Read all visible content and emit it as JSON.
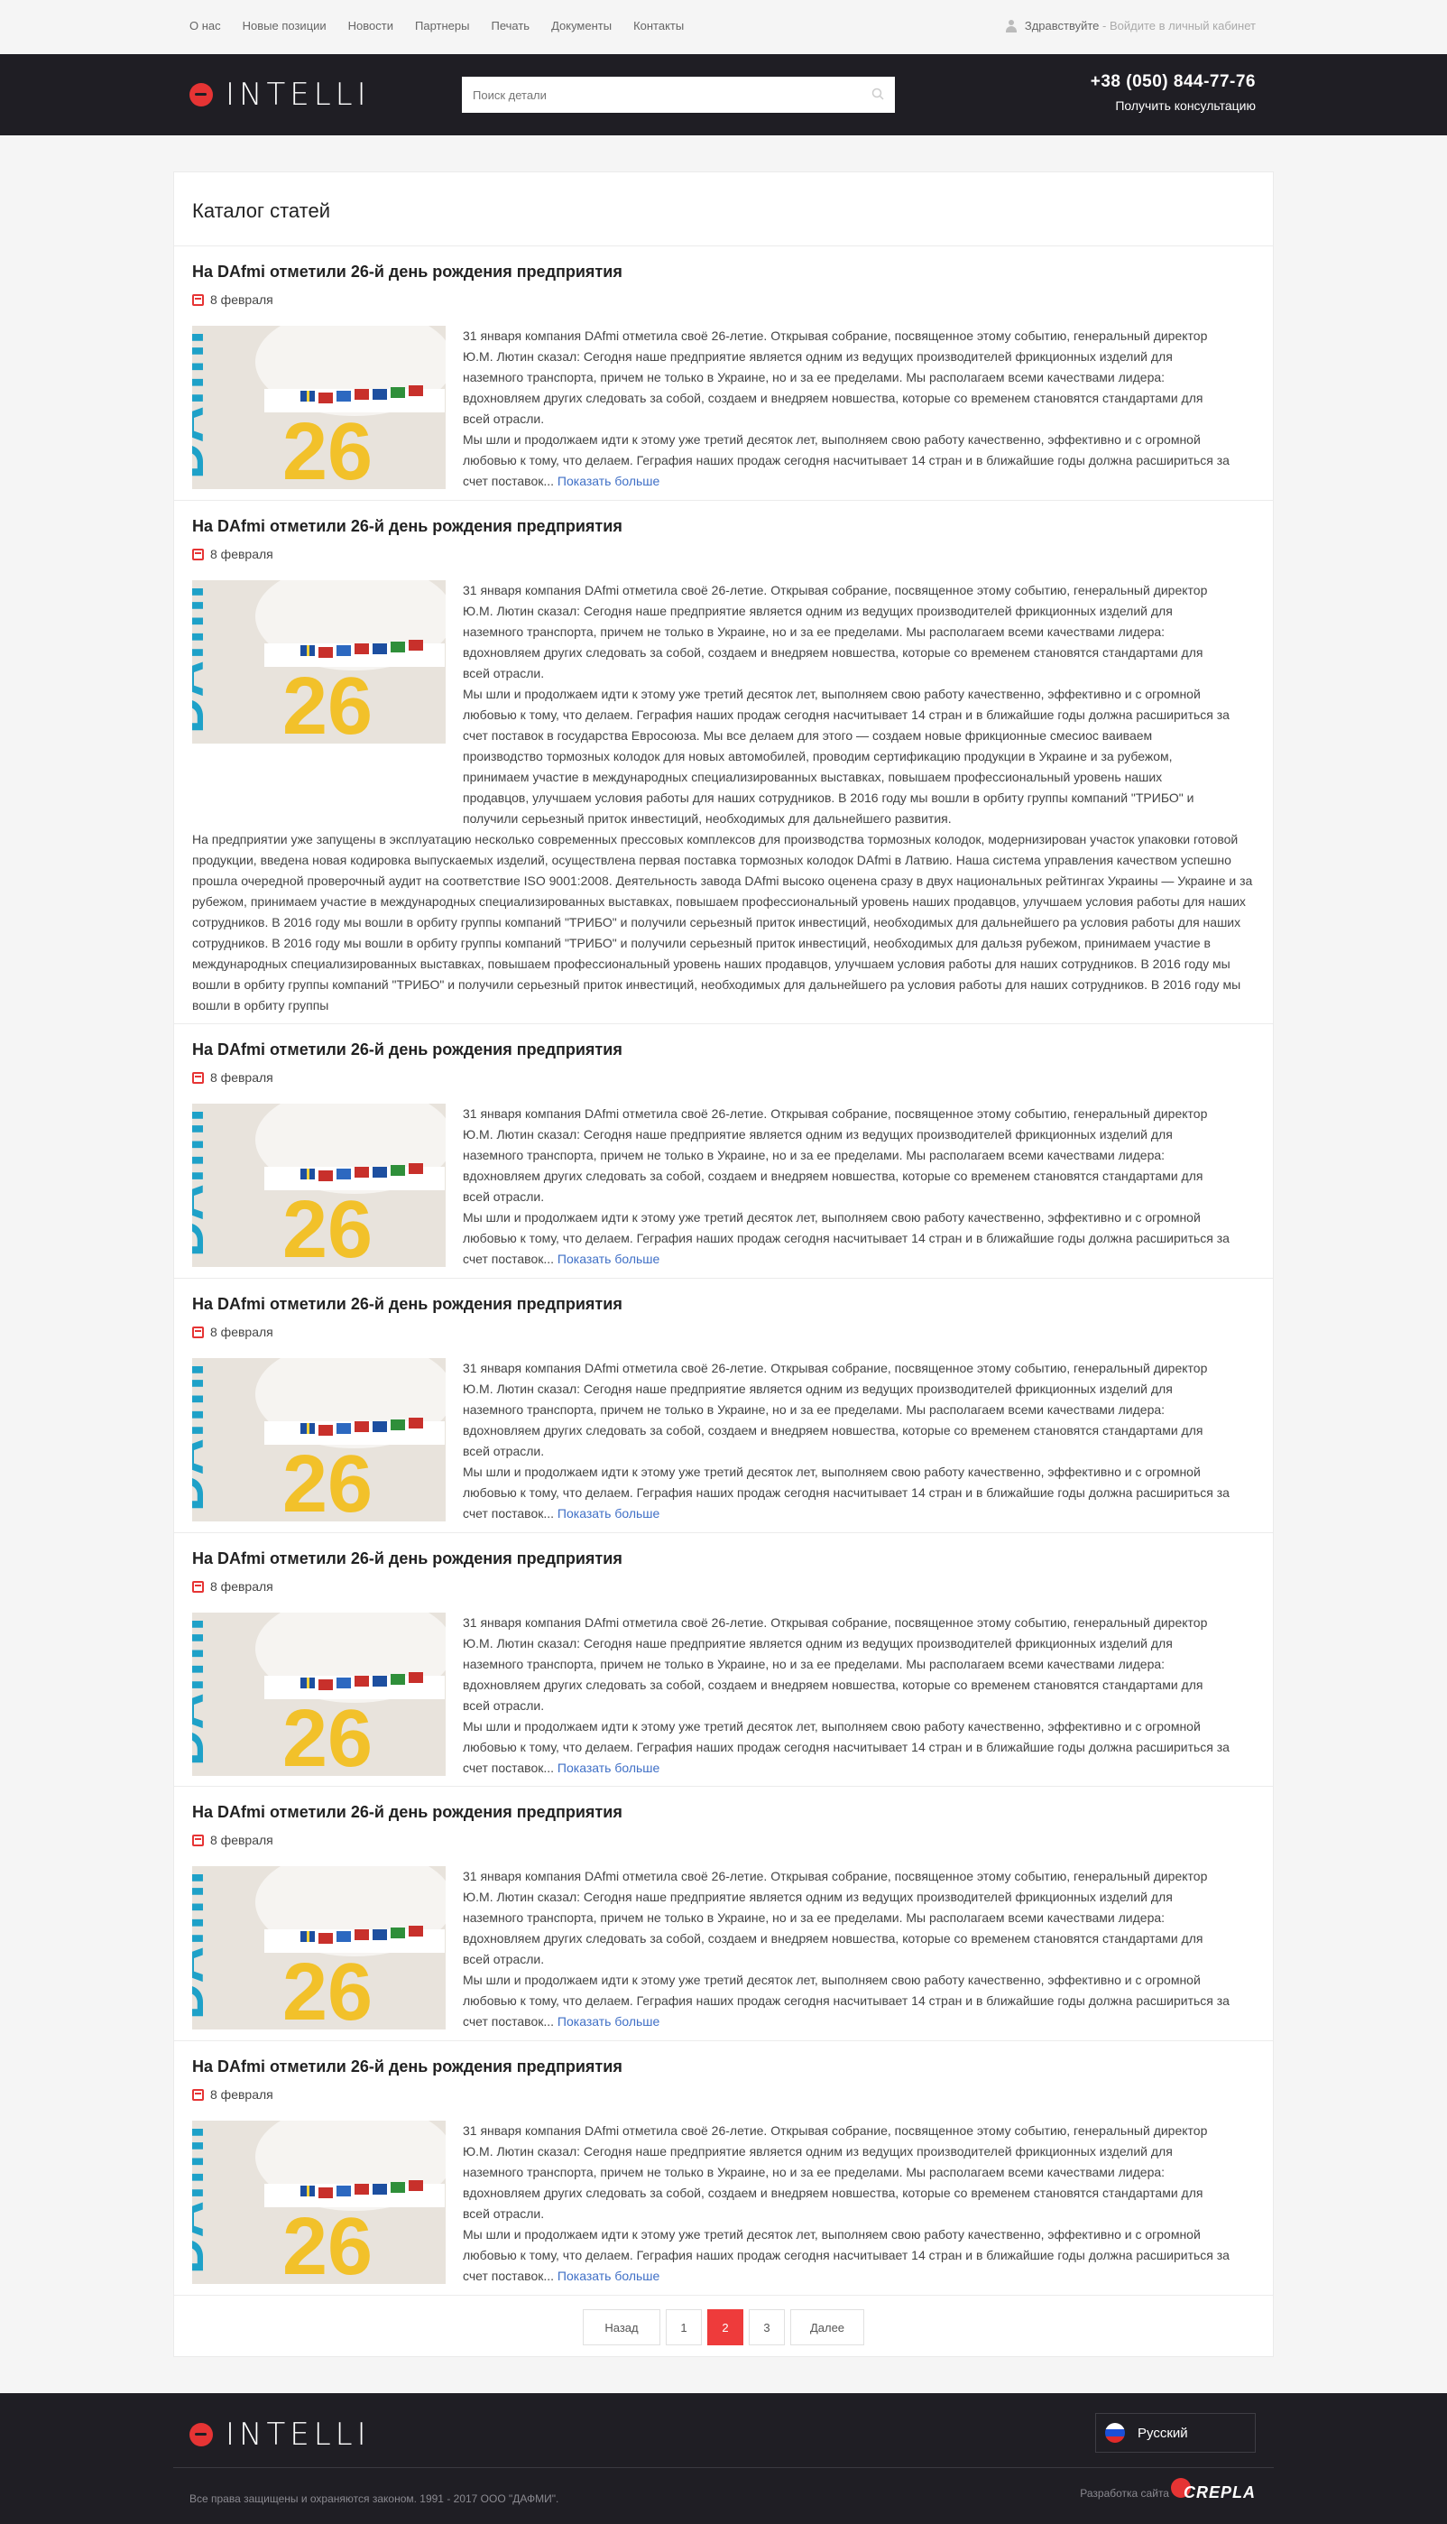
{
  "topbar": {
    "nav": [
      "О нас",
      "Новые позиции",
      "Новости",
      "Партнеры",
      "Печать",
      "Документы",
      "Контакты"
    ],
    "greeting": "Здравствуйте",
    "separator": " - ",
    "login_link": "Войдите в личный кабинет"
  },
  "header": {
    "logo_text": "INTELLI",
    "search_placeholder": "Поиск детали",
    "phone": "+38 (050) 844-77-76",
    "consult_label": "Получить консультацию"
  },
  "main": {
    "title": "Каталог статей",
    "articles": [
      {
        "title": "На DAfmi отметили 26-й день рождения предприятия",
        "date": "8 февраля",
        "text": "31 января компания DAfmi отметила своё 26-летие. Открывая собрание, посвященное этому событию, генеральный директор Ю.М. Лютин сказал: Сегодня наше предприятие является одним из ведущих производителей фрикционных изделий для наземного транспорта, причем не только в Украине, но и за ее пределами. Мы располагаем всеми качествами лидера: вдохновляем других следовать за собой, создаем и внедряем новшества, которые со временем становятся стандартами для всей отрасли.",
        "text2": "Мы шли и продолжаем идти к этому уже третий десяток лет, выполняем свою работу качественно, эффективно и с огромной любовью к тому, что делаем. Геграфия наших продаж сегодня насчитывает 14 стран и в ближайшие годы должна расшириться за счет поставок...",
        "more": "Показать больше"
      },
      {
        "title": "На DAfmi отметили 26-й день рождения предприятия",
        "date": "8 февраля",
        "text": "31 января компания DAfmi отметила своё 26-летие. Открывая собрание, посвященное этому событию, генеральный директор Ю.М. Лютин сказал: Сегодня наше предприятие является одним из ведущих производителей фрикционных изделий для наземного транспорта, причем не только в Украине, но и за ее пределами. Мы располагаем всеми качествами лидера: вдохновляем других следовать за собой, создаем и внедряем новшества, которые со временем становятся стандартами для всей отрасли.",
        "text2": "Мы шли и продолжаем идти к этому уже третий десяток лет, выполняем свою работу качественно, эффективно и с огромной любовью к тому, что делаем. Геграфия наших продаж сегодня насчитывает 14 стран и в ближайшие годы должна расшириться за счет поставок в государства Евросоюза. Мы все делаем для этого — создаем новые фрикционные смесиос ваиваем производство тормозных колодок для новых автомобилей, проводим сертификацию продукции в Украине и за рубежом, принимаем участие в международных специализированных выставках, повышаем профессиональный уровень наших продавцов, улучшаем условия работы для наших сотрудников. В 2016 году мы вошли в орбиту группы компаний \"ТРИБО\" и получили серьезный приток инвестиций, необходимых для дальнейшего развития.",
        "text3": "На предприятии уже запущены в эксплуатацию несколько современных прессовых комплексов для производства тормозных колодок, модернизирован участок упаковки готовой продукции, введена новая кодировка выпускаемых изделий, осуществлена первая поставка тормозных колодок DAfmi в Латвию. Наша система управления качеством успешно прошла очередной проверочный аудит на соответствие ISO 9001:2008. Деятельность завода DAfmi высоко оценена сразу в двух национальных рейтингах Украины — Украине и за рубежом, принимаем участие в международных специализированных выставках, повышаем профессиональный уровень наших продавцов, улучшаем условия работы для наших сотрудников. В 2016 году мы вошли в орбиту группы компаний \"ТРИБО\" и получили серьезный приток инвестиций, необходимых для дальнейшего ра условия работы для наших сотрудников. В 2016 году мы вошли в орбиту группы компаний \"ТРИБО\" и получили серьезный приток инвестиций, необходимых для дальзя рубежом, принимаем участие в международных специализированных выставках, повышаем профессиональный уровень наших продавцов, улучшаем условия работы для наших сотрудников. В 2016 году мы вошли в орбиту группы компаний \"ТРИБО\" и получили серьезный приток инвестиций, необходимых для дальнейшего ра условия работы для наших сотрудников. В 2016 году мы вошли в орбиту группы"
      },
      {
        "title": "На DAfmi отметили 26-й день рождения предприятия",
        "date": "8 февраля",
        "text": "31 января компания DAfmi отметила своё 26-летие. Открывая собрание, посвященное этому событию, генеральный директор Ю.М. Лютин сказал: Сегодня наше предприятие является одним из ведущих производителей фрикционных изделий для наземного транспорта, причем не только в Украине, но и за ее пределами. Мы располагаем всеми качествами лидера: вдохновляем других следовать за собой, создаем и внедряем новшества, которые со временем становятся стандартами для всей отрасли.",
        "text2": "Мы шли и продолжаем идти к этому уже третий десяток лет, выполняем свою работу качественно, эффективно и с огромной любовью к тому, что делаем. Геграфия наших продаж сегодня насчитывает 14 стран и в ближайшие годы должна расшириться за счет поставок...",
        "more": "Показать больше"
      },
      {
        "title": "На DAfmi отметили 26-й день рождения предприятия",
        "date": "8 февраля",
        "text": "31 января компания DAfmi отметила своё 26-летие. Открывая собрание, посвященное этому событию, генеральный директор Ю.М. Лютин сказал: Сегодня наше предприятие является одним из ведущих производителей фрикционных изделий для наземного транспорта, причем не только в Украине, но и за ее пределами. Мы располагаем всеми качествами лидера: вдохновляем других следовать за собой, создаем и внедряем новшества, которые со временем становятся стандартами для всей отрасли.",
        "text2": "Мы шли и продолжаем идти к этому уже третий десяток лет, выполняем свою работу качественно, эффективно и с огромной любовью к тому, что делаем. Геграфия наших продаж сегодня насчитывает 14 стран и в ближайшие годы должна расшириться за счет поставок...",
        "more": "Показать больше"
      },
      {
        "title": "На DAfmi отметили 26-й день рождения предприятия",
        "date": "8 февраля",
        "text": "31 января компания DAfmi отметила своё 26-летие. Открывая собрание, посвященное этому событию, генеральный директор Ю.М. Лютин сказал: Сегодня наше предприятие является одним из ведущих производителей фрикционных изделий для наземного транспорта, причем не только в Украине, но и за ее пределами. Мы располагаем всеми качествами лидера: вдохновляем других следовать за собой, создаем и внедряем новшества, которые со временем становятся стандартами для всей отрасли.",
        "text2": "Мы шли и продолжаем идти к этому уже третий десяток лет, выполняем свою работу качественно, эффективно и с огромной любовью к тому, что делаем. Геграфия наших продаж сегодня насчитывает 14 стран и в ближайшие годы должна расшириться за счет поставок...",
        "more": "Показать больше"
      },
      {
        "title": "На DAfmi отметили 26-й день рождения предприятия",
        "date": "8 февраля",
        "text": "31 января компания DAfmi отметила своё 26-летие. Открывая собрание, посвященное этому событию, генеральный директор Ю.М. Лютин сказал: Сегодня наше предприятие является одним из ведущих производителей фрикционных изделий для наземного транспорта, причем не только в Украине, но и за ее пределами. Мы располагаем всеми качествами лидера: вдохновляем других следовать за собой, создаем и внедряем новшества, которые со временем становятся стандартами для всей отрасли.",
        "text2": "Мы шли и продолжаем идти к этому уже третий десяток лет, выполняем свою работу качественно, эффективно и с огромной любовью к тому, что делаем. Геграфия наших продаж сегодня насчитывает 14 стран и в ближайшие годы должна расшириться за счет поставок...",
        "more": "Показать больше"
      },
      {
        "title": "На DAfmi отметили 26-й день рождения предприятия",
        "date": "8 февраля",
        "text": "31 января компания DAfmi отметила своё 26-летие. Открывая собрание, посвященное этому событию, генеральный директор Ю.М. Лютин сказал: Сегодня наше предприятие является одним из ведущих производителей фрикционных изделий для наземного транспорта, причем не только в Украине, но и за ее пределами. Мы располагаем всеми качествами лидера: вдохновляем других следовать за собой, создаем и внедряем новшества, которые со временем становятся стандартами для всей отрасли.",
        "text2": "Мы шли и продолжаем идти к этому уже третий десяток лет, выполняем свою работу качественно, эффективно и с огромной любовью к тому, что делаем. Геграфия наших продаж сегодня насчитывает 14 стран и в ближайшие годы должна расшириться за счет поставок...",
        "more": "Показать больше"
      }
    ],
    "thumb_text": "DAfmi",
    "thumb_number": "26"
  },
  "pagination": {
    "prev": "Назад",
    "pages": [
      "1",
      "2",
      "3"
    ],
    "active": "2",
    "next": "Далее"
  },
  "footer": {
    "logo_text": "INTELLI",
    "language": "Русский",
    "copyright": "Все права защищены и охраняются законом. 1991 - 2017 ООО \"ДАФМИ\".",
    "dev_label": "Разработка сайта",
    "dev_logo": "CREPLA"
  },
  "colors": {
    "accent": "#ee3b3b",
    "header_bg": "#1f1e24",
    "link": "#3f6fc6"
  }
}
